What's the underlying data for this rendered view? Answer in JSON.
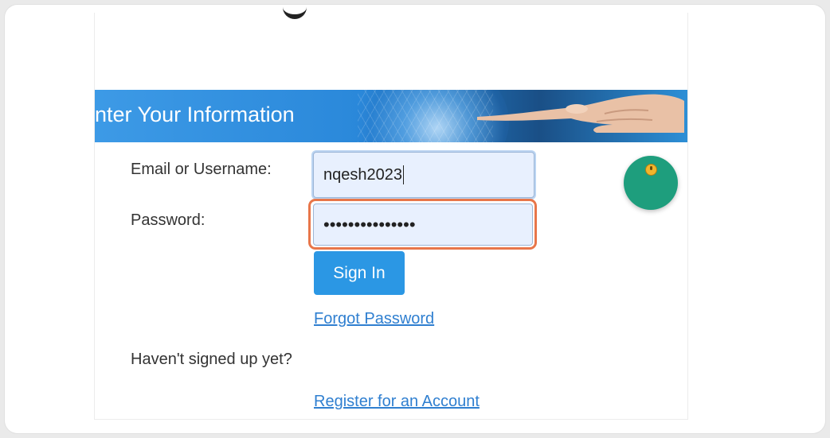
{
  "banner": {
    "title": "nter Your Information"
  },
  "form": {
    "email_label": "Email or Username:",
    "email_value": "nqesh2023",
    "password_label": "Password:",
    "password_masked": "•••••••••••••••",
    "signin_label": "Sign In",
    "forgot_link": "Forgot Password",
    "signup_prompt": "Haven't signed up yet?",
    "register_link": "Register for an Account"
  },
  "colors": {
    "banner_blue": "#2a88da",
    "button_blue": "#2b97e4",
    "link_blue": "#2f7fd0",
    "highlight_orange": "#e8764a",
    "marker_green": "#1e9e7d",
    "marker_dot": "#f2b52c"
  },
  "icons": {
    "click_marker": "click-indicator-icon"
  }
}
